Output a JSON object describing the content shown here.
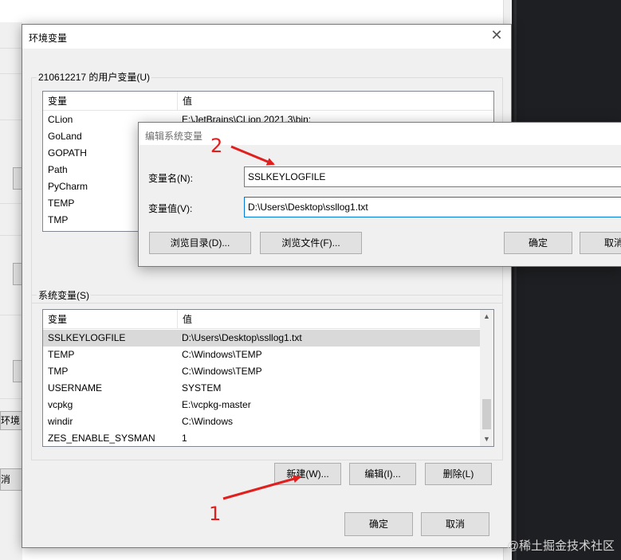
{
  "env_dialog": {
    "title": "环境变量",
    "close_glyph": "✕",
    "user_group": {
      "label": "210612217 的用户变量(U)",
      "col_name": "变量",
      "col_value": "值",
      "rows": [
        {
          "name": "CLion",
          "value": "E:\\JetBrains\\CLion 2021.3\\bin;"
        },
        {
          "name": "GoLand",
          "value": ""
        },
        {
          "name": "GOPATH",
          "value": ""
        },
        {
          "name": "Path",
          "value": ""
        },
        {
          "name": "PyCharm",
          "value": ""
        },
        {
          "name": "TEMP",
          "value": ""
        },
        {
          "name": "TMP",
          "value": ""
        }
      ]
    },
    "system_group": {
      "label": "系统变量(S)",
      "col_name": "变量",
      "col_value": "值",
      "rows": [
        {
          "name": "SSLKEYLOGFILE",
          "value": "D:\\Users\\Desktop\\ssllog1.txt",
          "selected": true
        },
        {
          "name": "TEMP",
          "value": "C:\\Windows\\TEMP"
        },
        {
          "name": "TMP",
          "value": "C:\\Windows\\TEMP"
        },
        {
          "name": "USERNAME",
          "value": "SYSTEM"
        },
        {
          "name": "vcpkg",
          "value": "E:\\vcpkg-master"
        },
        {
          "name": "windir",
          "value": "C:\\Windows"
        },
        {
          "name": "ZES_ENABLE_SYSMAN",
          "value": "1"
        }
      ],
      "new_button": "新建(W)...",
      "edit_button": "编辑(I)...",
      "delete_button": "删除(L)"
    },
    "ok_button": "确定",
    "cancel_button": "取消"
  },
  "edit_dialog": {
    "title": "编辑系统变量",
    "name_label": "变量名(N):",
    "name_value": "SSLKEYLOGFILE",
    "value_label": "变量值(V):",
    "value_value": "D:\\Users\\Desktop\\ssllog1.txt",
    "browse_dir_button": "浏览目录(D)...",
    "browse_file_button": "浏览文件(F)...",
    "ok_button": "确定",
    "cancel_button": "取消"
  },
  "background_window": {
    "env_button_text": "环境",
    "cancel_text": "消"
  },
  "annotations": {
    "step1": "1",
    "step2": "2",
    "color": "#e0201f"
  },
  "watermark": "@稀土掘金技术社区"
}
